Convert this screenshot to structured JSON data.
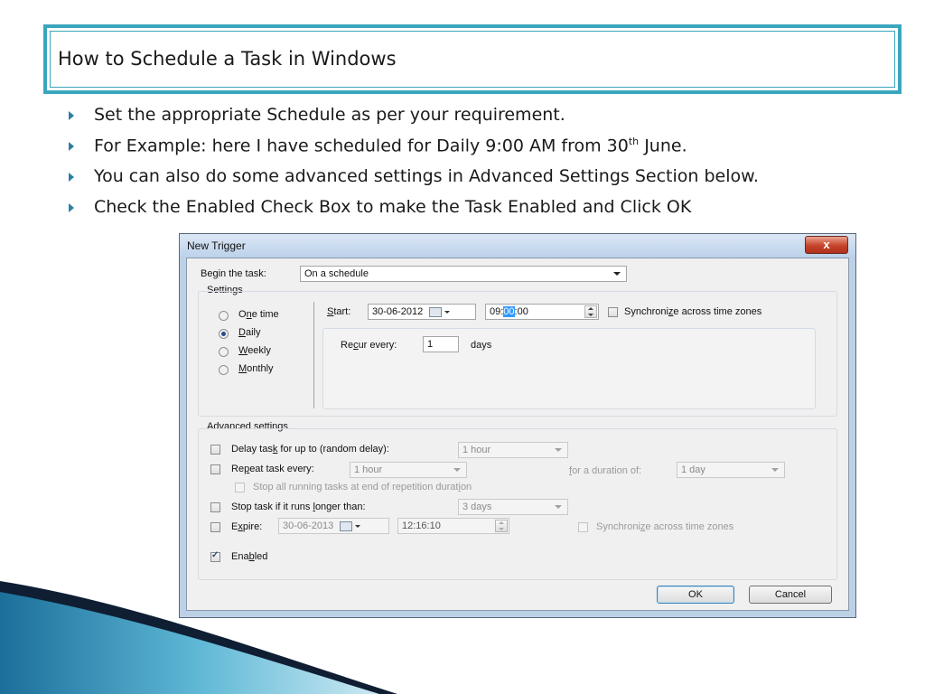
{
  "slide": {
    "title": "How to Schedule a Task in Windows",
    "bullets": [
      "Set the appropriate Schedule as per your requirement.",
      "You can also do some advanced settings in Advanced Settings Section below.",
      "Check the Enabled Check Box to make the Task Enabled and Click OK"
    ],
    "bullet2": {
      "pre": "For Example: here I have scheduled for Daily 9:00 AM from 30",
      "sup": "th",
      "post": " June."
    }
  },
  "dialog": {
    "title": "New Trigger",
    "close_label": "x",
    "begin": {
      "pre": "Be",
      "ul": "g",
      "post": "in the task:",
      "value": "On a schedule"
    },
    "settings_label": "Settings",
    "radios": [
      {
        "pre": "O",
        "ul": "n",
        "post": "e time",
        "selected": false
      },
      {
        "pre": "",
        "ul": "D",
        "post": "aily",
        "selected": true
      },
      {
        "pre": "",
        "ul": "W",
        "post": "eekly",
        "selected": false
      },
      {
        "pre": "",
        "ul": "M",
        "post": "onthly",
        "selected": false
      }
    ],
    "start": {
      "ul": "S",
      "post": "tart:",
      "date": "30-06-2012",
      "time_pre": "09:",
      "time_hl": "00",
      "time_post": ":00"
    },
    "sync": {
      "pre": "Synchroni",
      "ul": "z",
      "post": "e across time zones",
      "checked": false
    },
    "recur": {
      "pre": "Re",
      "ul": "c",
      "post": "ur every:",
      "value": "1",
      "unit": "days"
    },
    "advanced": {
      "label": "Advanced settings",
      "delay": {
        "pre": "Delay tas",
        "ul": "k",
        "post": " for up to (random delay):",
        "value": "1 hour",
        "checked": false
      },
      "repeat": {
        "pre": "Re",
        "ul": "p",
        "post": "eat task every:",
        "value": "1 hour",
        "checked": false,
        "duration_ul": "f",
        "duration_post": "or a duration of:",
        "duration_value": "1 day"
      },
      "stop_all": {
        "text": "Stop all running tasks at end of repetition durat",
        "ul": "i",
        "post": "on",
        "checked": false
      },
      "stop_longer": {
        "pre": "Stop task if it runs ",
        "ul": "l",
        "post": "onger than:",
        "value": "3 days",
        "checked": false
      },
      "expire": {
        "pre": "E",
        "ul": "x",
        "post": "pire:",
        "date": "30-06-2013",
        "time": "12:16:10",
        "checked": false
      },
      "expire_sync": {
        "pre": "Synchroni",
        "ul": "z",
        "post": "e across time zones",
        "checked": false
      },
      "enabled": {
        "pre": "Ena",
        "ul": "b",
        "post": "led",
        "checked": true
      }
    },
    "ok_label": "OK",
    "cancel_label": "Cancel"
  },
  "colors": {
    "accent": "#3aa6bd",
    "swoosh_dark": "#0f1e33",
    "swoosh_light": "#5fb8d6"
  }
}
